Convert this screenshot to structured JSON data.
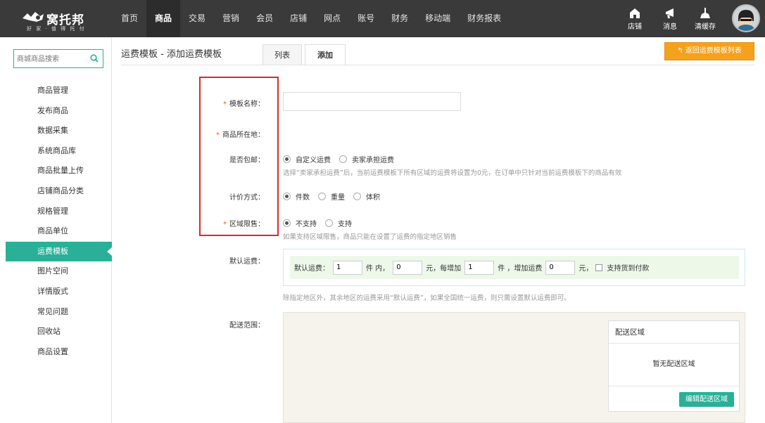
{
  "brand": {
    "name": "窝托邦",
    "slogan": "好 家 · 值 得 托 付"
  },
  "nav": {
    "items": [
      "首页",
      "商品",
      "交易",
      "营销",
      "会员",
      "店铺",
      "网点",
      "账号",
      "财务",
      "移动端",
      "财务报表"
    ],
    "active_index": 1
  },
  "tools": {
    "store": "店铺",
    "message": "消息",
    "clear_cache": "清缓存"
  },
  "sidebar": {
    "search_placeholder": "商城商品搜索",
    "items": [
      "商品管理",
      "发布商品",
      "数据采集",
      "系统商品库",
      "商品批量上传",
      "店铺商品分类",
      "规格管理",
      "商品单位",
      "运费模板",
      "图片空间",
      "详情版式",
      "常见问题",
      "回收站",
      "商品设置"
    ],
    "active_index": 8
  },
  "page": {
    "title": "运费模板 - 添加运费模板",
    "tabs": [
      "列表",
      "添加"
    ],
    "active_tab": 1,
    "back_button": "返回运费模板列表"
  },
  "form": {
    "name_label": "模板名称：",
    "name_value": "",
    "location_label": "商品所在地：",
    "free_shipping_label": "是否包邮：",
    "free_shipping_options": [
      "自定义运费",
      "卖家承担运费"
    ],
    "free_shipping_hint": "选择“卖家承担运费”后，当前运费模板下所有区域的运费将设置为0元，在订单中只针对当前运费模板下的商品有效",
    "pricing_label": "计价方式：",
    "pricing_options": [
      "件数",
      "重量",
      "体积"
    ],
    "region_label": "区域限售：",
    "region_options": [
      "不支持",
      "支持"
    ],
    "region_hint": "如果支持区域限售，商品只能在设置了运费的指定地区销售",
    "default_fee_label": "默认运费：",
    "fee": {
      "prefix": "默认运费：",
      "first_qty": "1",
      "unit1": "件 内，",
      "first_fee": "0",
      "unit2": "元，每增加",
      "add_qty": "1",
      "unit3": "件 ，增加运费",
      "add_fee": "0",
      "unit4": "元，",
      "cod_label": "支持货到付款"
    },
    "default_fee_hint": "除指定地区外，其余地区的运费采用“默认运费”，如果全国统一运费，则只需设置默认运费即可。",
    "scope_label": "配送范围：",
    "scope_panel_title": "配送区域",
    "scope_empty": "暂无配送区域",
    "scope_edit_button": "编辑配送区域"
  },
  "colors": {
    "accent": "#29b097",
    "topbar": "#3a3a3a",
    "back_button": "#f4a11c",
    "required": "#ff5a00",
    "highlight_box": "#e0262a"
  }
}
